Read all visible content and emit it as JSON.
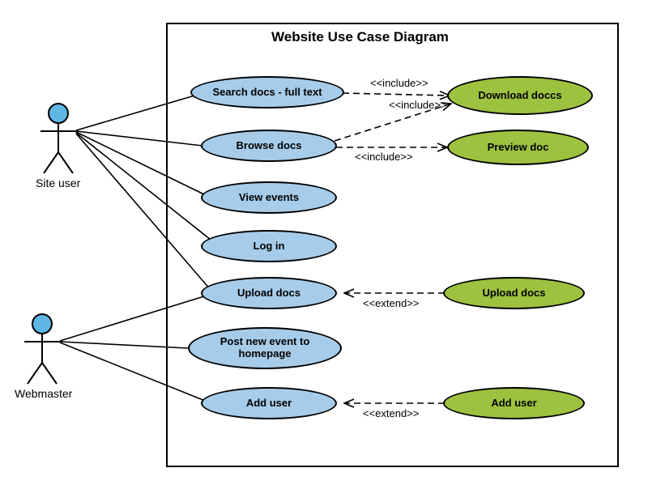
{
  "title": "Website Use Case Diagram",
  "actors": {
    "site_user": "Site user",
    "webmaster": "Webmaster"
  },
  "usecases_primary": {
    "search_docs": "Search docs - full text",
    "browse_docs": "Browse docs",
    "view_events": "View events",
    "log_in": "Log in",
    "upload_docs": "Upload docs",
    "post_event": "Post new event to homepage",
    "add_user": "Add user"
  },
  "usecases_included": {
    "download_docs": "Download doccs",
    "preview_doc": "Preview doc",
    "upload_docs_ext": "Upload docs",
    "add_user_ext": "Add user"
  },
  "stereotypes": {
    "include1": "<<include>>",
    "include2": "<<include>>",
    "include3": "<<include>>",
    "extend1": "<<extend>>",
    "extend2": "<<extend>>"
  },
  "chart_data": {
    "type": "uml-use-case",
    "title": "Website Use Case Diagram",
    "actors": [
      "Site user",
      "Webmaster"
    ],
    "use_cases": [
      {
        "name": "Search docs - full text",
        "color": "blue"
      },
      {
        "name": "Browse docs",
        "color": "blue"
      },
      {
        "name": "View events",
        "color": "blue"
      },
      {
        "name": "Log in",
        "color": "blue"
      },
      {
        "name": "Upload docs",
        "color": "blue"
      },
      {
        "name": "Post new event to homepage",
        "color": "blue"
      },
      {
        "name": "Add user",
        "color": "blue"
      },
      {
        "name": "Download doccs",
        "color": "green"
      },
      {
        "name": "Preview doc",
        "color": "green"
      },
      {
        "name": "Upload docs (ext)",
        "color": "green"
      },
      {
        "name": "Add user (ext)",
        "color": "green"
      }
    ],
    "associations": [
      {
        "actor": "Site user",
        "use_case": "Search docs - full text"
      },
      {
        "actor": "Site user",
        "use_case": "Browse docs"
      },
      {
        "actor": "Site user",
        "use_case": "View events"
      },
      {
        "actor": "Site user",
        "use_case": "Log in"
      },
      {
        "actor": "Site user",
        "use_case": "Upload docs"
      },
      {
        "actor": "Webmaster",
        "use_case": "Upload docs"
      },
      {
        "actor": "Webmaster",
        "use_case": "Post new event to homepage"
      },
      {
        "actor": "Webmaster",
        "use_case": "Add user"
      }
    ],
    "relationships": [
      {
        "from": "Search docs - full text",
        "to": "Download doccs",
        "type": "include"
      },
      {
        "from": "Browse docs",
        "to": "Download doccs",
        "type": "include"
      },
      {
        "from": "Browse docs",
        "to": "Preview doc",
        "type": "include"
      },
      {
        "from": "Upload docs (ext)",
        "to": "Upload docs",
        "type": "extend"
      },
      {
        "from": "Add user (ext)",
        "to": "Add user",
        "type": "extend"
      }
    ]
  }
}
